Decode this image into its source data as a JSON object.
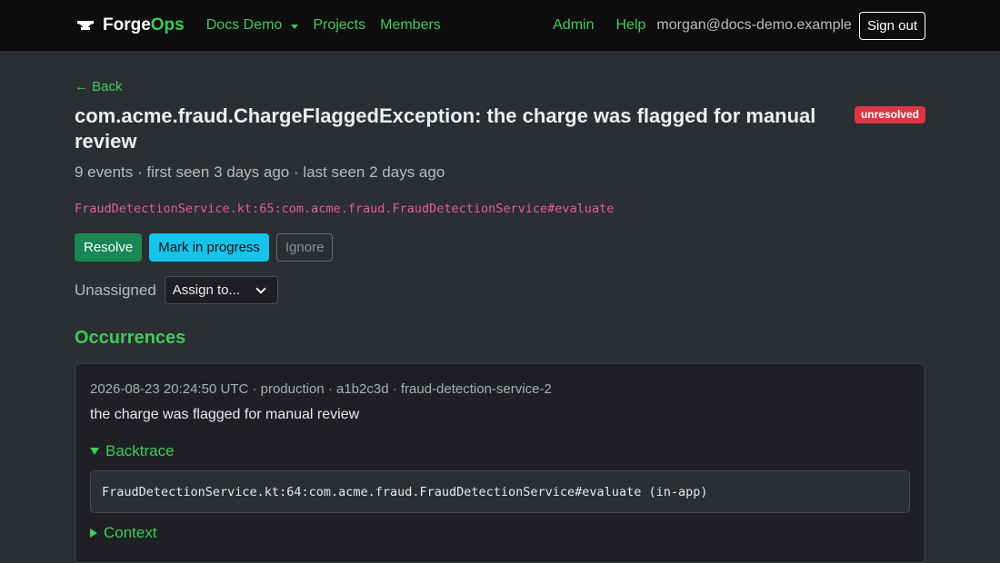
{
  "nav": {
    "brand_left": "Forge",
    "brand_right": "Ops",
    "project_menu": "Docs Demo",
    "projects": "Projects",
    "members": "Members",
    "admin": "Admin",
    "help": "Help",
    "user_email": "morgan@docs-demo.example",
    "sign_out": "Sign out"
  },
  "issue": {
    "back_label": "← Back",
    "title": "com.acme.fraud.ChargeFlaggedException: the charge was flagged for manual review",
    "status_badge": "unresolved",
    "summary": "9 events · first seen 3 days ago · last seen 2 days ago",
    "culprit": "FraudDetectionService.kt:65:com.acme.fraud.FraudDetectionService#evaluate",
    "actions": {
      "resolve": "Resolve",
      "mark_in_progress": "Mark in progress",
      "ignore": "Ignore"
    },
    "assignee_label": "Unassigned",
    "assign_select": "Assign to..."
  },
  "occurrences": {
    "heading": "Occurrences",
    "items": [
      {
        "meta": "2026-08-23 20:24:50 UTC · production · a1b2c3d · fraud-detection-service-2",
        "message": "the charge was flagged for manual review",
        "backtrace_label": "Backtrace",
        "backtrace_line": "FraudDetectionService.kt:64:com.acme.fraud.FraudDetectionService#evaluate (in-app)",
        "context_label": "Context"
      }
    ]
  },
  "colors": {
    "accent_green": "#3fcb57",
    "badge_red": "#dc3545",
    "resolve_green": "#198754",
    "progress_cyan": "#16c3ea",
    "culprit_pink": "#e35d9b"
  }
}
